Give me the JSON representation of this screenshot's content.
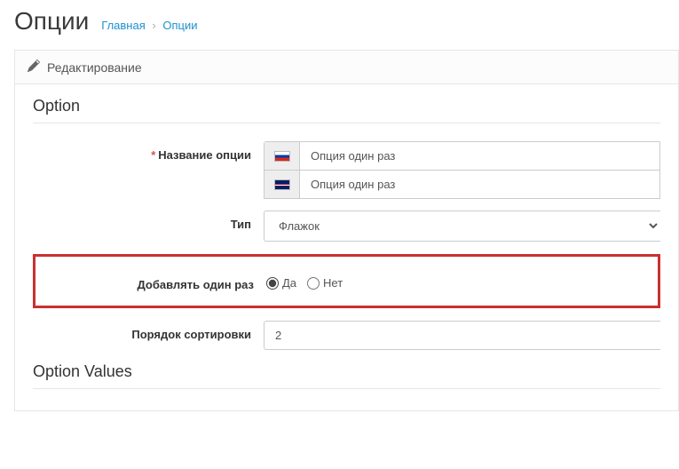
{
  "header": {
    "title": "Опции"
  },
  "breadcrumb": {
    "home": "Главная",
    "current": "Опции"
  },
  "panel": {
    "heading": "Редактирование"
  },
  "legend1": "Option",
  "legend2": "Option Values",
  "labels": {
    "option_name": "Название опции",
    "type": "Тип",
    "add_once": "Добавлять один раз",
    "sort_order": "Порядок сортировки"
  },
  "values": {
    "name_ru": "Опция один раз",
    "name_en": "Опция один раз",
    "type": "Флажок",
    "sort_order": "2"
  },
  "radio": {
    "yes": "Да",
    "no": "Нет"
  }
}
